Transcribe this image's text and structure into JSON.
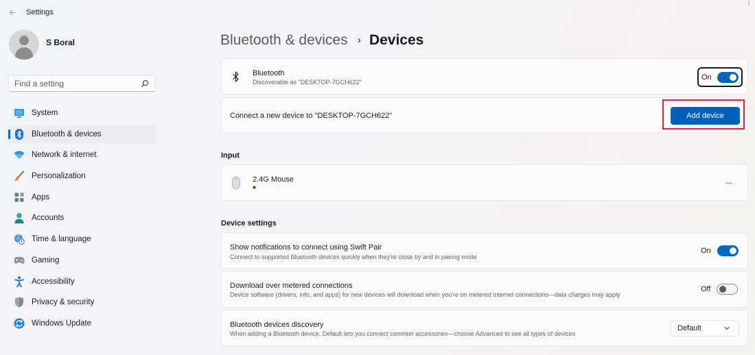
{
  "app": {
    "title": "Settings"
  },
  "user": {
    "name": "S Boral"
  },
  "search": {
    "placeholder": "Find a setting"
  },
  "sidebar": {
    "items": [
      {
        "label": "System",
        "icon": "system-icon"
      },
      {
        "label": "Bluetooth & devices",
        "icon": "bluetooth-icon",
        "active": true
      },
      {
        "label": "Network & internet",
        "icon": "wifi-icon"
      },
      {
        "label": "Personalization",
        "icon": "brush-icon"
      },
      {
        "label": "Apps",
        "icon": "apps-icon"
      },
      {
        "label": "Accounts",
        "icon": "person-icon"
      },
      {
        "label": "Time & language",
        "icon": "globe-clock-icon"
      },
      {
        "label": "Gaming",
        "icon": "gamepad-icon"
      },
      {
        "label": "Accessibility",
        "icon": "accessibility-icon"
      },
      {
        "label": "Privacy & security",
        "icon": "shield-icon"
      },
      {
        "label": "Windows Update",
        "icon": "update-icon"
      }
    ]
  },
  "breadcrumb": {
    "parent": "Bluetooth & devices",
    "separator": "›",
    "current": "Devices"
  },
  "bluetooth": {
    "title": "Bluetooth",
    "subtitle": "Discoverable as \"DESKTOP-7GCH622\"",
    "state_label": "On",
    "enabled": true
  },
  "connect": {
    "text": "Connect a new device to \"DESKTOP-7GCH622\"",
    "button_label": "Add device"
  },
  "input_section": {
    "header": "Input",
    "device_name": "2.4G Mouse",
    "more_label": "..."
  },
  "device_settings": {
    "header": "Device settings",
    "swift_pair": {
      "title": "Show notifications to connect using Swift Pair",
      "subtitle": "Connect to supported Bluetooth devices quickly when they're close by and in pairing mode",
      "state_label": "On",
      "enabled": true
    },
    "metered": {
      "title": "Download over metered connections",
      "subtitle": "Device software (drivers, info, and apps) for new devices will download when you're on metered internet connections—data charges may apply",
      "state_label": "Off",
      "enabled": false
    },
    "discovery": {
      "title": "Bluetooth devices discovery",
      "subtitle": "When adding a Bluetooth device, Default lets you connect common accessories—choose Advanced to see all types of devices",
      "selected": "Default"
    }
  },
  "colors": {
    "accent": "#0067c0",
    "highlight": "#d9202c",
    "connected_dot": "#0f7b0f"
  }
}
